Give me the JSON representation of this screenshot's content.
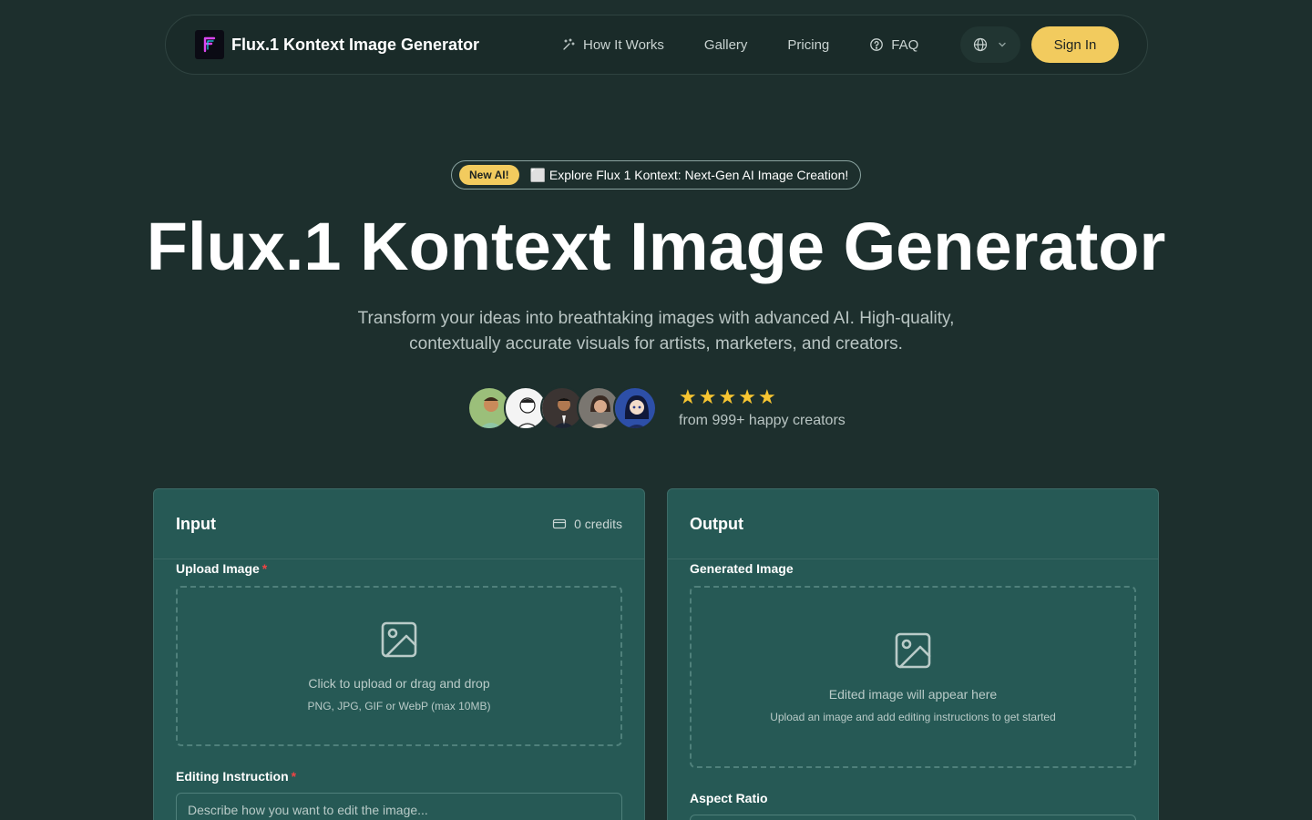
{
  "nav": {
    "brand": "Flux.1 Kontext Image Generator",
    "links": [
      {
        "label": "How It Works",
        "icon": "sparkles-icon"
      },
      {
        "label": "Gallery"
      },
      {
        "label": "Pricing"
      },
      {
        "label": "FAQ",
        "icon": "help-circle-icon"
      }
    ],
    "language_icon": "globe-icon",
    "signin": "Sign In"
  },
  "hero": {
    "badge": "New AI!",
    "announcement": "⬜ Explore Flux 1 Kontext: Next-Gen AI Image Creation!",
    "title": "Flux.1 Kontext Image Generator",
    "subtitle_line1": "Transform your ideas into breathtaking images with advanced AI. High-quality,",
    "subtitle_line2": "contextually accurate visuals for artists, marketers, and creators.",
    "rating_stars": 5,
    "rating_text": "from 999+ happy creators"
  },
  "input_panel": {
    "title": "Input",
    "credits": "0 credits",
    "upload_label": "Upload Image",
    "required_mark": "*",
    "upload_main": "Click to upload or drag and drop",
    "upload_sub": "PNG, JPG, GIF or WebP (max 10MB)",
    "instruction_label": "Editing Instruction",
    "instruction_placeholder": "Describe how you want to edit the image..."
  },
  "output_panel": {
    "title": "Output",
    "generated_label": "Generated Image",
    "empty_main": "Edited image will appear here",
    "empty_sub": "Upload an image and add editing instructions to get started",
    "aspect_label": "Aspect Ratio"
  },
  "colors": {
    "background": "#1d2f2d",
    "panel": "#265955",
    "accent": "#f2cb5e",
    "star": "#f7c531"
  }
}
